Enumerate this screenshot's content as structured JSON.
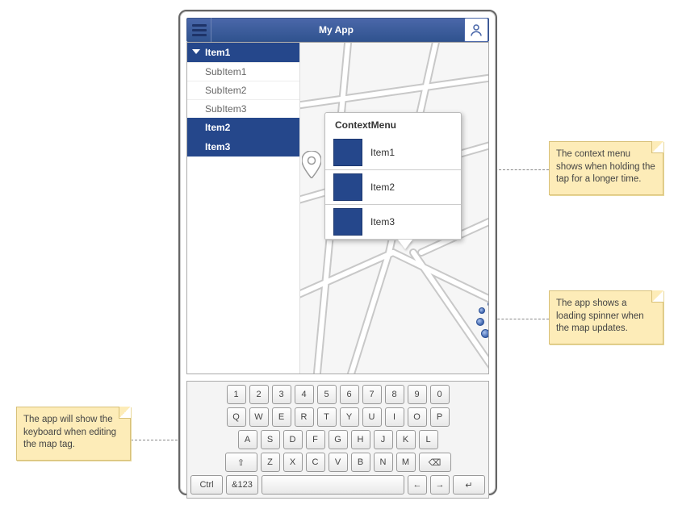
{
  "app": {
    "title": "My App"
  },
  "sidebar": {
    "items": [
      {
        "label": "Item1",
        "expanded": true,
        "subitems": [
          "SubItem1",
          "SubItem2",
          "SubItem3"
        ]
      },
      {
        "label": "Item2"
      },
      {
        "label": "Item3"
      }
    ]
  },
  "contextMenu": {
    "title": "ContextMenu",
    "items": [
      "Item1",
      "Item2",
      "Item3"
    ]
  },
  "keyboard": {
    "rows": [
      [
        "1",
        "2",
        "3",
        "4",
        "5",
        "6",
        "7",
        "8",
        "9",
        "0"
      ],
      [
        "Q",
        "W",
        "E",
        "R",
        "T",
        "Y",
        "U",
        "I",
        "O",
        "P"
      ],
      [
        "A",
        "S",
        "D",
        "F",
        "G",
        "H",
        "J",
        "K",
        "L"
      ],
      [
        "⇧",
        "Z",
        "X",
        "C",
        "V",
        "B",
        "N",
        "M",
        "⌫"
      ],
      [
        "Ctrl",
        "&123",
        "␣",
        "←",
        "→",
        "↵"
      ]
    ]
  },
  "annotations": {
    "contextMenuNote": "The context menu shows when holding the tap for a longer time.",
    "spinnerNote": "The app shows a loading spinner when the map updates.",
    "keyboardNote": "The app will show the keyboard when editing the map tag."
  }
}
